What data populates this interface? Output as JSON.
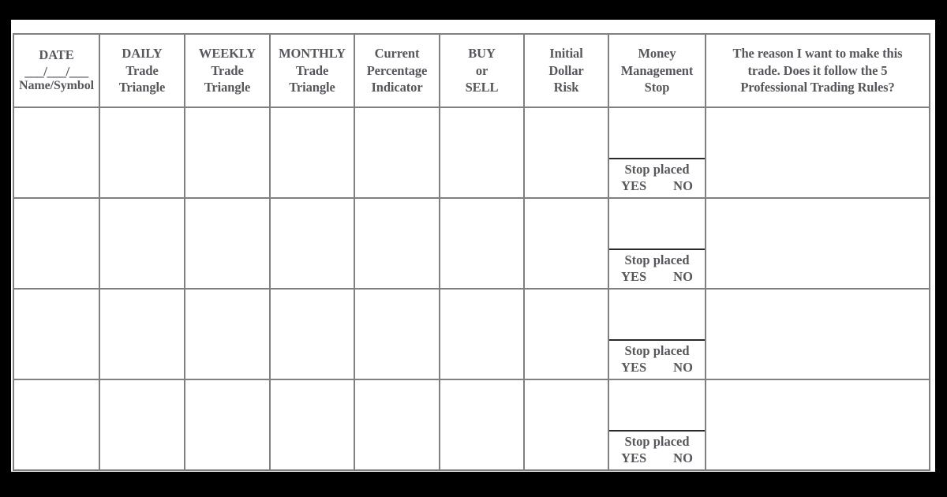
{
  "page": {
    "background_color": "#ffffff",
    "frame_color": "#000000",
    "border_color": "#808080",
    "text_color": "#56565c"
  },
  "table": {
    "headers": [
      {
        "id": "date",
        "type": "date-block",
        "title": "DATE",
        "blanks": "___/___/___",
        "subtitle": "Name/Symbol"
      },
      {
        "id": "daily-trade-triangle",
        "type": "text",
        "lines": [
          "DAILY",
          "Trade",
          "Triangle"
        ]
      },
      {
        "id": "weekly-trade-triangle",
        "type": "text",
        "lines": [
          "WEEKLY",
          "Trade",
          "Triangle"
        ]
      },
      {
        "id": "monthly-trade-triangle",
        "type": "text",
        "lines": [
          "MONTHLY",
          "Trade",
          "Triangle"
        ]
      },
      {
        "id": "current-percentage-indicator",
        "type": "text",
        "lines": [
          "Current",
          "Percentage",
          "Indicator"
        ]
      },
      {
        "id": "buy-or-sell",
        "type": "text",
        "lines": [
          "BUY",
          "or",
          "SELL"
        ]
      },
      {
        "id": "initial-dollar-risk",
        "type": "text",
        "lines": [
          "Initial",
          "Dollar",
          "Risk"
        ]
      },
      {
        "id": "money-management-stop",
        "type": "text",
        "lines": [
          "Money",
          "Management",
          "Stop"
        ]
      },
      {
        "id": "reason-for-trade",
        "type": "text",
        "lines": [
          "The reason I want to make this",
          "trade. Does it follow the 5",
          "Professional Trading Rules?"
        ]
      }
    ],
    "stop_cell": {
      "label": "Stop placed",
      "yes_label": "YES",
      "no_label": "NO"
    },
    "rows": [
      {
        "date": "",
        "daily": "",
        "weekly": "",
        "monthly": "",
        "cpi": "",
        "buysell": "",
        "risk": "",
        "mmstop": "",
        "reason": ""
      },
      {
        "date": "",
        "daily": "",
        "weekly": "",
        "monthly": "",
        "cpi": "",
        "buysell": "",
        "risk": "",
        "mmstop": "",
        "reason": ""
      },
      {
        "date": "",
        "daily": "",
        "weekly": "",
        "monthly": "",
        "cpi": "",
        "buysell": "",
        "risk": "",
        "mmstop": "",
        "reason": ""
      },
      {
        "date": "",
        "daily": "",
        "weekly": "",
        "monthly": "",
        "cpi": "",
        "buysell": "",
        "risk": "",
        "mmstop": "",
        "reason": ""
      }
    ]
  }
}
